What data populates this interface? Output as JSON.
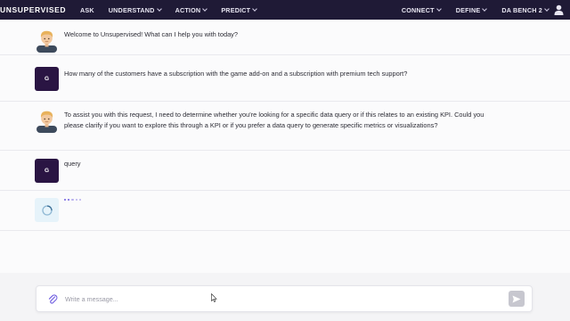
{
  "app": {
    "logo": "UNSUPERVISED"
  },
  "nav": {
    "left": [
      {
        "label": "ASK",
        "has_caret": false
      },
      {
        "label": "UNDERSTAND",
        "has_caret": true
      },
      {
        "label": "ACTION",
        "has_caret": true
      },
      {
        "label": "PREDICT",
        "has_caret": true
      }
    ],
    "right": [
      {
        "label": "CONNECT",
        "has_caret": true
      },
      {
        "label": "DEFINE",
        "has_caret": true
      },
      {
        "label": "DA BENCH 2",
        "has_caret": true
      }
    ]
  },
  "messages": [
    {
      "role": "assistant",
      "text": "Welcome to Unsupervised! What can I help you with today?"
    },
    {
      "role": "user",
      "initial": "G",
      "text": "How many of the customers have a subscription with the game add-on and a subscription with premium tech support?"
    },
    {
      "role": "assistant",
      "text": "To assist you with this request, I need to determine whether you're looking for a specific data query or if this relates to an existing KPI. Could you please clarify if you want to explore this through a KPI or if you prefer a data query to generate specific metrics or visualizations?"
    },
    {
      "role": "user",
      "initial": "G",
      "text": "query"
    }
  ],
  "input": {
    "placeholder": "Write a message..."
  },
  "colors": {
    "topbar": "#1f1a36",
    "user_avatar": "#2a1543",
    "accent": "#6f5de0"
  }
}
